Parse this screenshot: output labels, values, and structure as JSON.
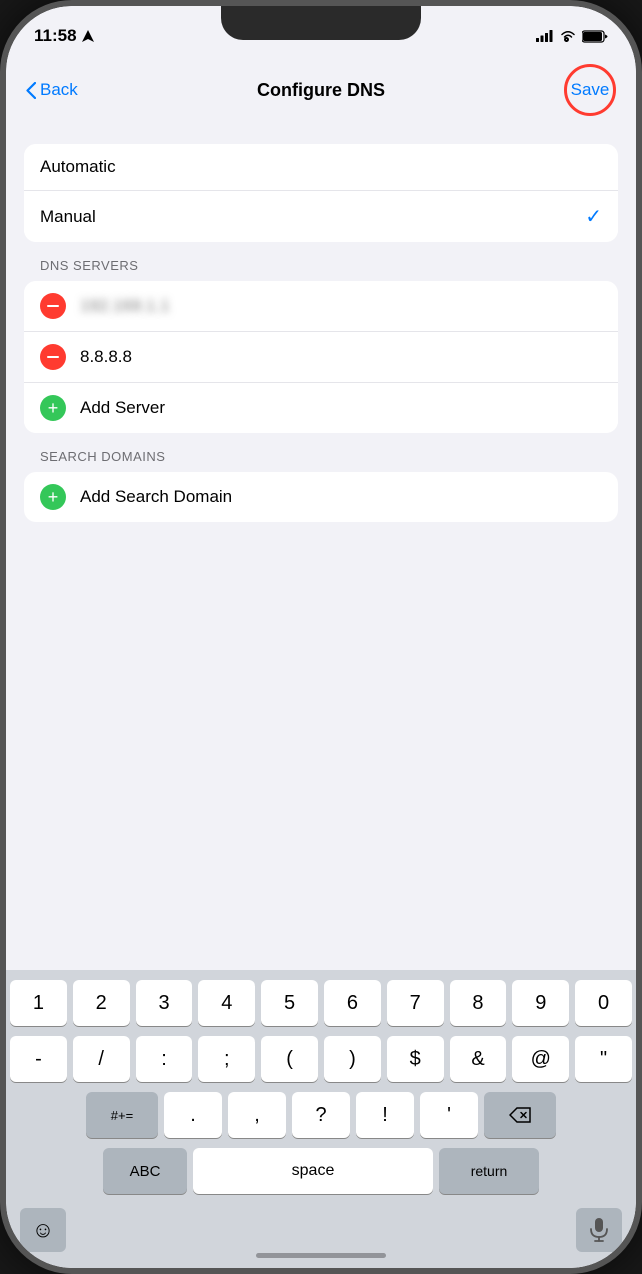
{
  "status": {
    "time": "11:58",
    "time_icon": "location-arrow"
  },
  "nav": {
    "back_label": "Back",
    "title": "Configure DNS",
    "save_label": "Save"
  },
  "dns_mode": {
    "options": [
      {
        "label": "Automatic",
        "selected": false
      },
      {
        "label": "Manual",
        "selected": true
      }
    ]
  },
  "sections": {
    "dns_servers": {
      "header": "DNS SERVERS",
      "servers": [
        {
          "ip": "192.168.1.1",
          "blurred": true
        },
        {
          "ip": "8.8.8.8",
          "blurred": false
        }
      ],
      "add_label": "Add Server"
    },
    "search_domains": {
      "header": "SEARCH DOMAINS",
      "add_label": "Add Search Domain"
    }
  },
  "keyboard": {
    "row1": [
      "1",
      "2",
      "3",
      "4",
      "5",
      "6",
      "7",
      "8",
      "9",
      "0"
    ],
    "row2": [
      "-",
      "/",
      ":",
      ";",
      "(",
      ")",
      "$",
      "&",
      "@",
      "\""
    ],
    "row3_special": "#+=",
    "row3_keys": [
      ".",
      ",",
      "?",
      "!",
      "'"
    ],
    "space_label": "space",
    "return_label": "return",
    "abc_label": "ABC"
  }
}
